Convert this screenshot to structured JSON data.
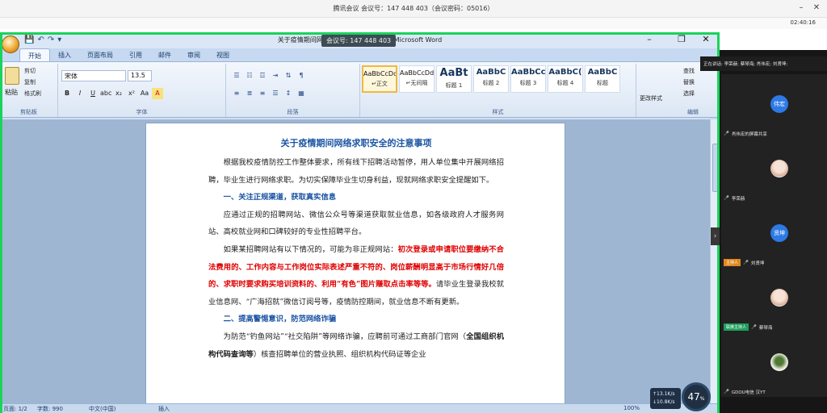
{
  "meeting": {
    "info": "腾讯会议 会议号：147 448 403（会议密码：05016）",
    "min_icon": "minimize-icon",
    "min_label": "–",
    "close_label": "✕",
    "timer": "02:40:16",
    "speaking": "正在讲话: 李荣赫; 蔡琴海; 肖伟宏; 刘贤坤;"
  },
  "word": {
    "title": "关于疫情期间网络求职安全的注意事项 - Microsoft Word",
    "share_pill": "会议号: 147 448 403",
    "qat": [
      "💾",
      "↶",
      "↷",
      "▾"
    ],
    "window_min": "–",
    "window_restore": "❐",
    "window_close": "✕",
    "tabs": [
      "开始",
      "插入",
      "页面布局",
      "引用",
      "邮件",
      "审阅",
      "视图"
    ],
    "clipboard": {
      "paste": "粘贴",
      "cut": "剪切",
      "copy": "复制",
      "painter": "格式刷",
      "group": "剪贴板"
    },
    "font": {
      "name": "宋体",
      "size": "13.5",
      "group": "字体"
    },
    "font_buttons": [
      "B",
      "I",
      "U",
      "abc",
      "x₂",
      "x²",
      "Aa",
      "A"
    ],
    "paragraph_group": "段落",
    "styles": [
      {
        "sample": "AaBbCcDd",
        "name": "↵正文",
        "kind": "small",
        "selected": true
      },
      {
        "sample": "AaBbCcDd",
        "name": "↵无间隔",
        "kind": "small",
        "selected": false
      },
      {
        "sample": "AaBt",
        "name": "标题 1",
        "kind": "big",
        "selected": false
      },
      {
        "sample": "AaBbC",
        "name": "标题 2",
        "kind": "mid",
        "selected": false
      },
      {
        "sample": "AaBbCc",
        "name": "标题 3",
        "kind": "mid",
        "selected": false
      },
      {
        "sample": "AaBbC(",
        "name": "标题 4",
        "kind": "mid",
        "selected": false
      },
      {
        "sample": "AaBbC",
        "name": "标题",
        "kind": "mid",
        "selected": false
      }
    ],
    "change_styles": "更改样式",
    "styles_group": "样式",
    "editing": {
      "find": "查找",
      "replace": "替换",
      "select": "选择",
      "group": "编辑"
    },
    "status": {
      "page": "页面: 1/2",
      "words": "字数: 990",
      "lang": "中文(中国)",
      "mode": "插入",
      "zoom": "100%"
    }
  },
  "document": {
    "title": "关于疫情期间网络求职安全的注意事项",
    "p1": "根据我校疫情防控工作整体要求，所有线下招聘活动暂停，用人单位集中开展网络招聘，毕业生进行网络求职。为切实保障毕业生切身利益，现就网络求职安全提醒如下。",
    "h1": "一、关注正规渠道，获取真实信息",
    "p2": "应通过正规的招聘网站、微信公众号等渠道获取就业信息，如各级政府人才服务网站、高校就业网和口碑较好的专业性招聘平台。",
    "p3_a": "如果某招聘网站有以下情况的，可能为非正规网站：",
    "p3_red": "初次登录或申请职位要缴纳不合法费用的、工作内容与工作岗位实际表述严重不符的、岗位薪酬明显高于市场行情好几倍的、求职时要求购买培训资料的、利用“有色”图片赚取点击率等等。",
    "p3_b": "请毕业生登录我校就业信息网、“广海招就”微信订阅号等，疫情防控期间，就业信息不断有更新。",
    "h2": "二、提高警惕意识，防范网络诈骗",
    "p4_a": "为防范“钓鱼网站”“社交陷阱”等网络诈骗，应聘前可通过工商部门官网（",
    "p4_bold": "全国组织机构代码查询等",
    "p4_b": "）核查招聘单位的营业执照、组织机构代码证等企业"
  },
  "participants": [
    {
      "initials": "伟宏",
      "name": "肖伟宏的屏幕共享",
      "kind": "blue",
      "badge": "",
      "badge_kind": ""
    },
    {
      "initials": "",
      "name": "李荣赫",
      "kind": "photo",
      "badge": "",
      "badge_kind": ""
    },
    {
      "initials": "贤坤",
      "name": "刘贤坤",
      "kind": "blue",
      "badge": "主持人",
      "badge_kind": "host"
    },
    {
      "initials": "",
      "name": "蔡琴海",
      "kind": "photo",
      "badge": "联席主持人",
      "badge_kind": "cohost"
    },
    {
      "initials": "",
      "name": "GDOU电信 汉YT",
      "kind": "photo2",
      "badge": "",
      "badge_kind": ""
    }
  ],
  "network": {
    "up": "↑13.1K/s",
    "down": "↓10.8K/s"
  },
  "cpu": {
    "value": "47",
    "unit": "%"
  }
}
